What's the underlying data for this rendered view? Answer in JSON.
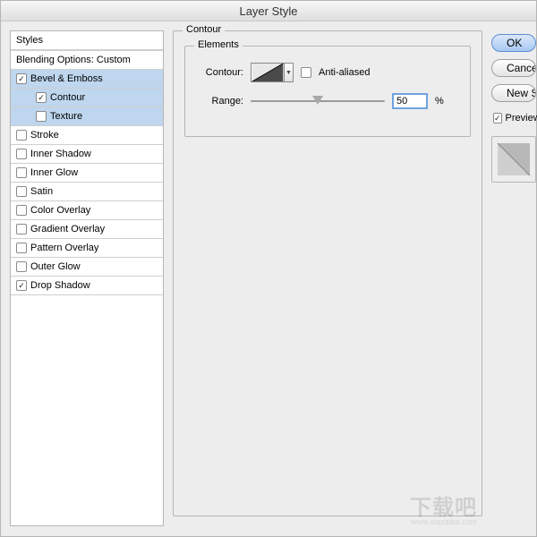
{
  "window": {
    "title": "Layer Style"
  },
  "sidebar": {
    "header": "Styles",
    "blending": "Blending Options: Custom",
    "items": [
      {
        "label": "Bevel & Emboss",
        "checked": true,
        "selected": true,
        "sub": false
      },
      {
        "label": "Contour",
        "checked": true,
        "selected": true,
        "sub": true
      },
      {
        "label": "Texture",
        "checked": false,
        "selected": true,
        "sub": true
      },
      {
        "label": "Stroke",
        "checked": false,
        "selected": false,
        "sub": false
      },
      {
        "label": "Inner Shadow",
        "checked": false,
        "selected": false,
        "sub": false
      },
      {
        "label": "Inner Glow",
        "checked": false,
        "selected": false,
        "sub": false
      },
      {
        "label": "Satin",
        "checked": false,
        "selected": false,
        "sub": false
      },
      {
        "label": "Color Overlay",
        "checked": false,
        "selected": false,
        "sub": false
      },
      {
        "label": "Gradient Overlay",
        "checked": false,
        "selected": false,
        "sub": false
      },
      {
        "label": "Pattern Overlay",
        "checked": false,
        "selected": false,
        "sub": false
      },
      {
        "label": "Outer Glow",
        "checked": false,
        "selected": false,
        "sub": false
      },
      {
        "label": "Drop Shadow",
        "checked": true,
        "selected": false,
        "sub": false
      }
    ]
  },
  "panel": {
    "group": "Contour",
    "subgroup": "Elements",
    "contour_label": "Contour:",
    "antialiased_label": "Anti-aliased",
    "antialiased_checked": false,
    "range_label": "Range:",
    "range_value": "50",
    "range_unit": "%"
  },
  "rightcol": {
    "ok": "OK",
    "cancel": "Cancel",
    "newstyle": "New Style...",
    "preview_label": "Preview",
    "preview_checked": true
  },
  "watermark": {
    "text": "下载吧",
    "url": "www.xiazaiba.com"
  }
}
